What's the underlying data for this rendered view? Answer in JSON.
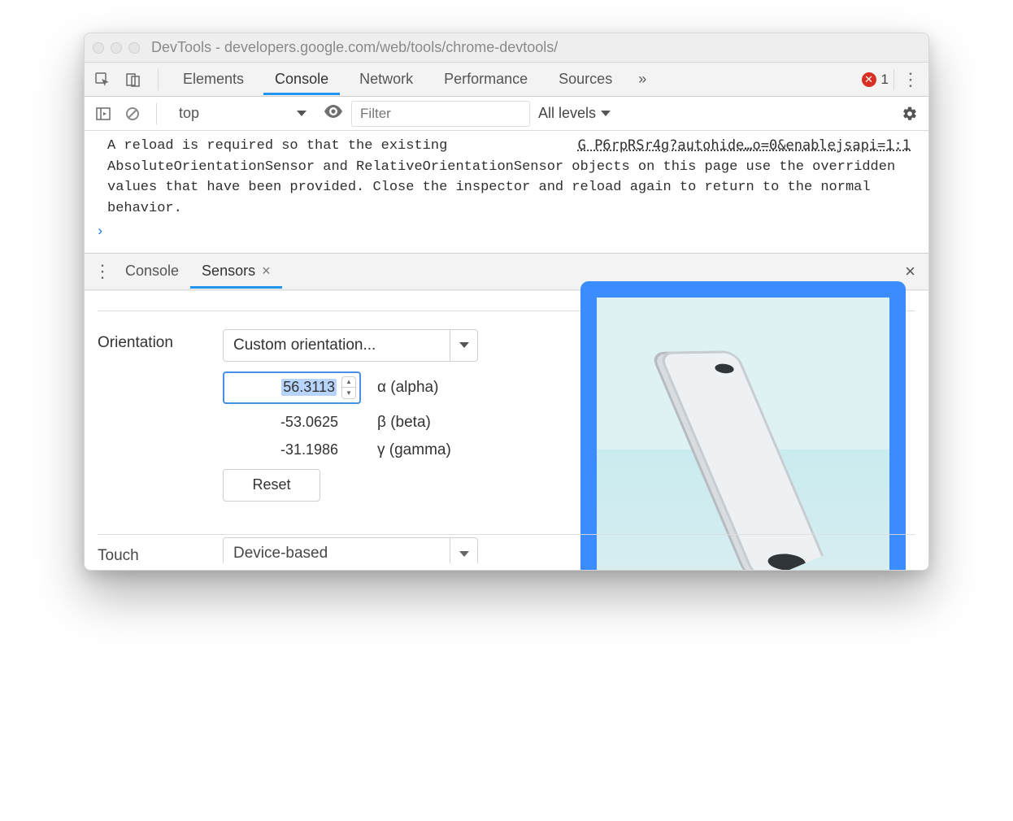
{
  "window": {
    "title": "DevTools - developers.google.com/web/tools/chrome-devtools/"
  },
  "tabs": {
    "items": [
      "Elements",
      "Console",
      "Network",
      "Performance",
      "Sources"
    ],
    "active_index": 1,
    "more_glyph": "»",
    "error_count": "1"
  },
  "console_toolbar": {
    "context": "top",
    "filter_placeholder": "Filter",
    "levels_label": "All levels"
  },
  "console_message": {
    "text": "A reload is required so that the existing AbsoluteOrientationSensor and RelativeOrientationSensor objects on this page use the overridden values that have been provided. Close the inspector and reload again to return to the normal behavior.",
    "source_link": "G P6rpRSr4g?autohide…o=0&enablejsapi=1:1",
    "prompt_glyph": "›"
  },
  "drawer": {
    "tabs": [
      "Console",
      "Sensors"
    ],
    "active_index": 1
  },
  "sensors": {
    "orientation": {
      "label": "Orientation",
      "preset_label": "Custom orientation...",
      "alpha": {
        "value": "56.3113",
        "label": "α (alpha)"
      },
      "beta": {
        "value": "-53.0625",
        "label": "β (beta)"
      },
      "gamma": {
        "value": "-31.1986",
        "label": "γ (gamma)"
      },
      "reset_label": "Reset"
    },
    "touch": {
      "label": "Touch",
      "preset_label": "Device-based"
    }
  }
}
